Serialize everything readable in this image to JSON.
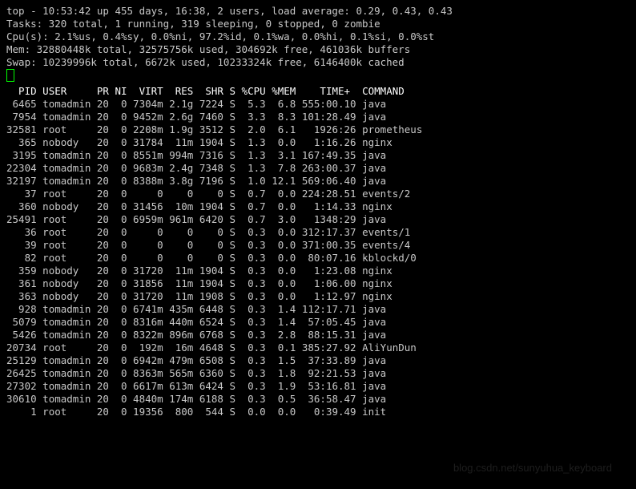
{
  "summary": {
    "line1": "top - 10:53:42 up 455 days, 16:38,  2 users,  load average: 0.29, 0.43, 0.43",
    "line2": "Tasks: 320 total,   1 running, 319 sleeping,   0 stopped,   0 zombie",
    "line3": "Cpu(s):  2.1%us,  0.4%sy,  0.0%ni, 97.2%id,  0.1%wa,  0.0%hi,  0.1%si,  0.0%st",
    "line4": "Mem:  32880448k total, 32575756k used,   304692k free,   461036k buffers",
    "line5": "Swap: 10239996k total,     6672k used, 10233324k free,  6146400k cached"
  },
  "columns": [
    "  PID",
    " USER    ",
    " PR",
    " NI",
    " VIRT",
    " RES",
    " SHR",
    " S",
    " %CPU",
    " %MEM",
    "    TIME+ ",
    " COMMAND  "
  ],
  "rows": [
    {
      "pid": " 6465",
      "user": " tomadmin",
      "pr": " 20",
      "ni": "  0",
      "virt": " 7304m",
      "res": " 2.1g",
      "shr": " 7224",
      "s": " S",
      "cpu": "  5.3",
      "mem": "  6.8",
      "time": " 555:00.10",
      "cmd": " java"
    },
    {
      "pid": " 7954",
      "user": " tomadmin",
      "pr": " 20",
      "ni": "  0",
      "virt": " 9452m",
      "res": " 2.6g",
      "shr": " 7460",
      "s": " S",
      "cpu": "  3.3",
      "mem": "  8.3",
      "time": " 101:28.49",
      "cmd": " java"
    },
    {
      "pid": "32581",
      "user": " root    ",
      "pr": " 20",
      "ni": "  0",
      "virt": " 2208m",
      "res": " 1.9g",
      "shr": " 3512",
      "s": " S",
      "cpu": "  2.0",
      "mem": "  6.1",
      "time": "   1926:26",
      "cmd": " prometheus"
    },
    {
      "pid": "  365",
      "user": " nobody  ",
      "pr": " 20",
      "ni": "  0",
      "virt": " 31784",
      "res": "  11m",
      "shr": " 1904",
      "s": " S",
      "cpu": "  1.3",
      "mem": "  0.0",
      "time": "   1:16.26",
      "cmd": " nginx"
    },
    {
      "pid": " 3195",
      "user": " tomadmin",
      "pr": " 20",
      "ni": "  0",
      "virt": " 8551m",
      "res": " 994m",
      "shr": " 7316",
      "s": " S",
      "cpu": "  1.3",
      "mem": "  3.1",
      "time": " 167:49.35",
      "cmd": " java"
    },
    {
      "pid": "22304",
      "user": " tomadmin",
      "pr": " 20",
      "ni": "  0",
      "virt": " 9683m",
      "res": " 2.4g",
      "shr": " 7348",
      "s": " S",
      "cpu": "  1.3",
      "mem": "  7.8",
      "time": " 263:00.37",
      "cmd": " java"
    },
    {
      "pid": "32197",
      "user": " tomadmin",
      "pr": " 20",
      "ni": "  0",
      "virt": " 8388m",
      "res": " 3.8g",
      "shr": " 7196",
      "s": " S",
      "cpu": "  1.0",
      "mem": " 12.1",
      "time": " 569:06.40",
      "cmd": " java"
    },
    {
      "pid": "   37",
      "user": " root    ",
      "pr": " 20",
      "ni": "  0",
      "virt": "     0",
      "res": "    0",
      "shr": "    0",
      "s": " S",
      "cpu": "  0.7",
      "mem": "  0.0",
      "time": " 224:28.51",
      "cmd": " events/2"
    },
    {
      "pid": "  360",
      "user": " nobody  ",
      "pr": " 20",
      "ni": "  0",
      "virt": " 31456",
      "res": "  10m",
      "shr": " 1904",
      "s": " S",
      "cpu": "  0.7",
      "mem": "  0.0",
      "time": "   1:14.33",
      "cmd": " nginx"
    },
    {
      "pid": "25491",
      "user": " root    ",
      "pr": " 20",
      "ni": "  0",
      "virt": " 6959m",
      "res": " 961m",
      "shr": " 6420",
      "s": " S",
      "cpu": "  0.7",
      "mem": "  3.0",
      "time": "   1348:29",
      "cmd": " java"
    },
    {
      "pid": "   36",
      "user": " root    ",
      "pr": " 20",
      "ni": "  0",
      "virt": "     0",
      "res": "    0",
      "shr": "    0",
      "s": " S",
      "cpu": "  0.3",
      "mem": "  0.0",
      "time": " 312:17.37",
      "cmd": " events/1"
    },
    {
      "pid": "   39",
      "user": " root    ",
      "pr": " 20",
      "ni": "  0",
      "virt": "     0",
      "res": "    0",
      "shr": "    0",
      "s": " S",
      "cpu": "  0.3",
      "mem": "  0.0",
      "time": " 371:00.35",
      "cmd": " events/4"
    },
    {
      "pid": "   82",
      "user": " root    ",
      "pr": " 20",
      "ni": "  0",
      "virt": "     0",
      "res": "    0",
      "shr": "    0",
      "s": " S",
      "cpu": "  0.3",
      "mem": "  0.0",
      "time": "  80:07.16",
      "cmd": " kblockd/0"
    },
    {
      "pid": "  359",
      "user": " nobody  ",
      "pr": " 20",
      "ni": "  0",
      "virt": " 31720",
      "res": "  11m",
      "shr": " 1904",
      "s": " S",
      "cpu": "  0.3",
      "mem": "  0.0",
      "time": "   1:23.08",
      "cmd": " nginx"
    },
    {
      "pid": "  361",
      "user": " nobody  ",
      "pr": " 20",
      "ni": "  0",
      "virt": " 31856",
      "res": "  11m",
      "shr": " 1904",
      "s": " S",
      "cpu": "  0.3",
      "mem": "  0.0",
      "time": "   1:06.00",
      "cmd": " nginx"
    },
    {
      "pid": "  363",
      "user": " nobody  ",
      "pr": " 20",
      "ni": "  0",
      "virt": " 31720",
      "res": "  11m",
      "shr": " 1908",
      "s": " S",
      "cpu": "  0.3",
      "mem": "  0.0",
      "time": "   1:12.97",
      "cmd": " nginx"
    },
    {
      "pid": "  928",
      "user": " tomadmin",
      "pr": " 20",
      "ni": "  0",
      "virt": " 6741m",
      "res": " 435m",
      "shr": " 6448",
      "s": " S",
      "cpu": "  0.3",
      "mem": "  1.4",
      "time": " 112:17.71",
      "cmd": " java"
    },
    {
      "pid": " 5079",
      "user": " tomadmin",
      "pr": " 20",
      "ni": "  0",
      "virt": " 8316m",
      "res": " 440m",
      "shr": " 6524",
      "s": " S",
      "cpu": "  0.3",
      "mem": "  1.4",
      "time": "  57:05.45",
      "cmd": " java"
    },
    {
      "pid": " 5426",
      "user": " tomadmin",
      "pr": " 20",
      "ni": "  0",
      "virt": " 8322m",
      "res": " 896m",
      "shr": " 6768",
      "s": " S",
      "cpu": "  0.3",
      "mem": "  2.8",
      "time": "  88:15.31",
      "cmd": " java"
    },
    {
      "pid": "20734",
      "user": " root    ",
      "pr": " 20",
      "ni": "  0",
      "virt": "  192m",
      "res": "  16m",
      "shr": " 4648",
      "s": " S",
      "cpu": "  0.3",
      "mem": "  0.1",
      "time": " 385:27.92",
      "cmd": " AliYunDun"
    },
    {
      "pid": "25129",
      "user": " tomadmin",
      "pr": " 20",
      "ni": "  0",
      "virt": " 6942m",
      "res": " 479m",
      "shr": " 6508",
      "s": " S",
      "cpu": "  0.3",
      "mem": "  1.5",
      "time": "  37:33.89",
      "cmd": " java"
    },
    {
      "pid": "26425",
      "user": " tomadmin",
      "pr": " 20",
      "ni": "  0",
      "virt": " 8363m",
      "res": " 565m",
      "shr": " 6360",
      "s": " S",
      "cpu": "  0.3",
      "mem": "  1.8",
      "time": "  92:21.53",
      "cmd": " java"
    },
    {
      "pid": "27302",
      "user": " tomadmin",
      "pr": " 20",
      "ni": "  0",
      "virt": " 6617m",
      "res": " 613m",
      "shr": " 6424",
      "s": " S",
      "cpu": "  0.3",
      "mem": "  1.9",
      "time": "  53:16.81",
      "cmd": " java"
    },
    {
      "pid": "30610",
      "user": " tomadmin",
      "pr": " 20",
      "ni": "  0",
      "virt": " 4840m",
      "res": " 174m",
      "shr": " 6188",
      "s": " S",
      "cpu": "  0.3",
      "mem": "  0.5",
      "time": "  36:58.47",
      "cmd": " java"
    },
    {
      "pid": "    1",
      "user": " root    ",
      "pr": " 20",
      "ni": "  0",
      "virt": " 19356",
      "res": "  800",
      "shr": "  544",
      "s": " S",
      "cpu": "  0.0",
      "mem": "  0.0",
      "time": "   0:39.49",
      "cmd": " init"
    }
  ],
  "watermark": "blog.csdn.net/sunyuhua_keyboard"
}
